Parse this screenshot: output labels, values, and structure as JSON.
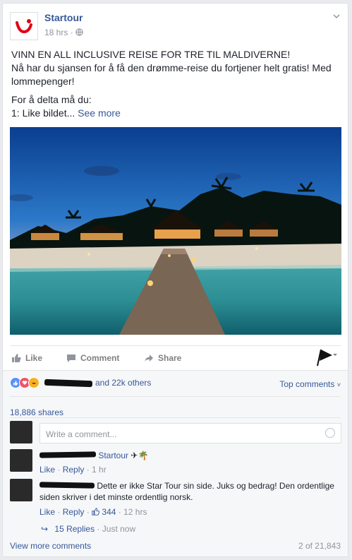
{
  "post": {
    "page_name": "Startour",
    "time": "18 hrs",
    "sep": "·",
    "headline": "VINN EN ALL INCLUSIVE REISE FOR TRE TIL MALDIVERNE!",
    "body": "Nå har du sjansen for å få den drømme-reise du fortjener helt gratis! Med lommepenger!",
    "instruction": "For å delta må du:",
    "step": "1: Like bildet",
    "ellipsis": "...",
    "see_more": "See more"
  },
  "actions": {
    "like": "Like",
    "comment": "Comment",
    "share": "Share"
  },
  "social": {
    "reactions_text": "and 22k others",
    "top_comments": "Top comments",
    "shares": "18,886 shares",
    "comment_placeholder": "Write a comment..."
  },
  "comments": [
    {
      "text": "Startour",
      "like": "Like",
      "reply": "Reply",
      "time": "1 hr"
    },
    {
      "text": "Dette er ikke Star Tour sin side. Juks og bedrag! Den ordentlige siden skriver i det minste ordentlig norsk.",
      "like": "Like",
      "reply": "Reply",
      "likes_count": "344",
      "time": "12 hrs",
      "replies": "15 Replies",
      "replies_time": "Just now"
    }
  ],
  "footer": {
    "view_more": "View more comments",
    "counter": "2 of 21,843"
  },
  "colors": {
    "link": "#365899",
    "muted": "#90949c",
    "brand_red": "#e10514"
  },
  "icons": [
    "tui-logo-icon",
    "globe-icon",
    "chevron-down-icon",
    "thumbs-up-icon",
    "comment-icon",
    "share-arrow-icon",
    "flag-icon",
    "like-reaction-icon",
    "love-reaction-icon",
    "haha-reaction-icon",
    "smiley-icon",
    "airplane-icon",
    "palm-tree-icon",
    "reply-arrow-icon"
  ]
}
